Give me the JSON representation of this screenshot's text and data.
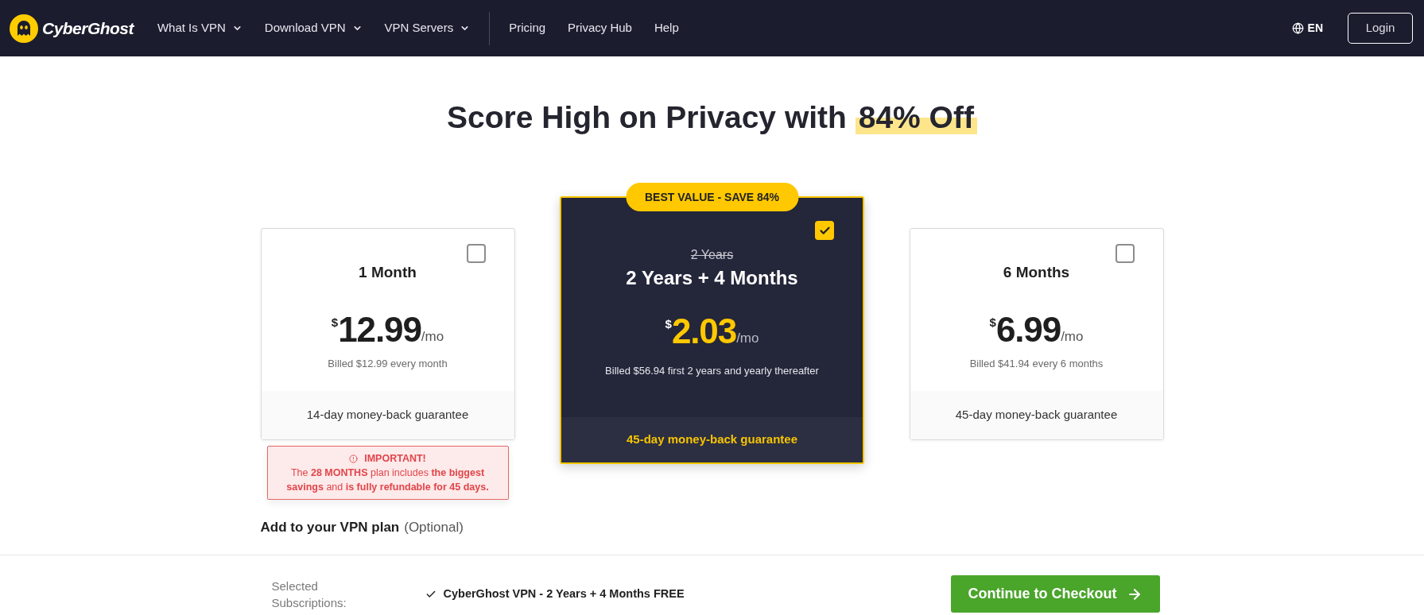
{
  "header": {
    "logo": "CyberGhost",
    "nav_menus": [
      "What Is VPN",
      "Download VPN",
      "VPN Servers"
    ],
    "nav_links": [
      "Pricing",
      "Privacy Hub",
      "Help"
    ],
    "language": "EN",
    "login": "Login"
  },
  "title": "Score High on Privacy with",
  "title_highlight": "84% Off",
  "plans": [
    {
      "kind": "standard",
      "selected": false,
      "name": "1 Month",
      "currency": "$",
      "price": "12.99",
      "unit": "/mo",
      "billing": "Billed $12.99 every month",
      "guarantee": "14-day money-back guarantee",
      "notice": {
        "heading": "IMPORTANT!",
        "text": "The **28 MONTHS** plan includes **the biggest savings** and **is fully refundable for 45 days.**"
      }
    },
    {
      "kind": "featured",
      "selected": true,
      "badge": "BEST VALUE - SAVE 84%",
      "old_name": "2 Years",
      "name": "2 Years + 4 Months",
      "currency": "$",
      "price": "2.03",
      "unit": "/mo",
      "billing": "Billed $56.94 first 2 years and yearly thereafter",
      "guarantee": "45-day money-back guarantee"
    },
    {
      "kind": "standard",
      "selected": false,
      "name": "6 Months",
      "currency": "$",
      "price": "6.99",
      "unit": "/mo",
      "billing": "Billed $41.94 every 6 months",
      "guarantee": "45-day money-back guarantee"
    }
  ],
  "addons": {
    "title": "Add to your VPN plan",
    "note": "(Optional)"
  },
  "checkout_bar": {
    "label": "Selected Subscriptions:",
    "items": [
      "CyberGhost VPN - 2 Years + 4 Months FREE"
    ],
    "button": "Continue to Checkout"
  }
}
